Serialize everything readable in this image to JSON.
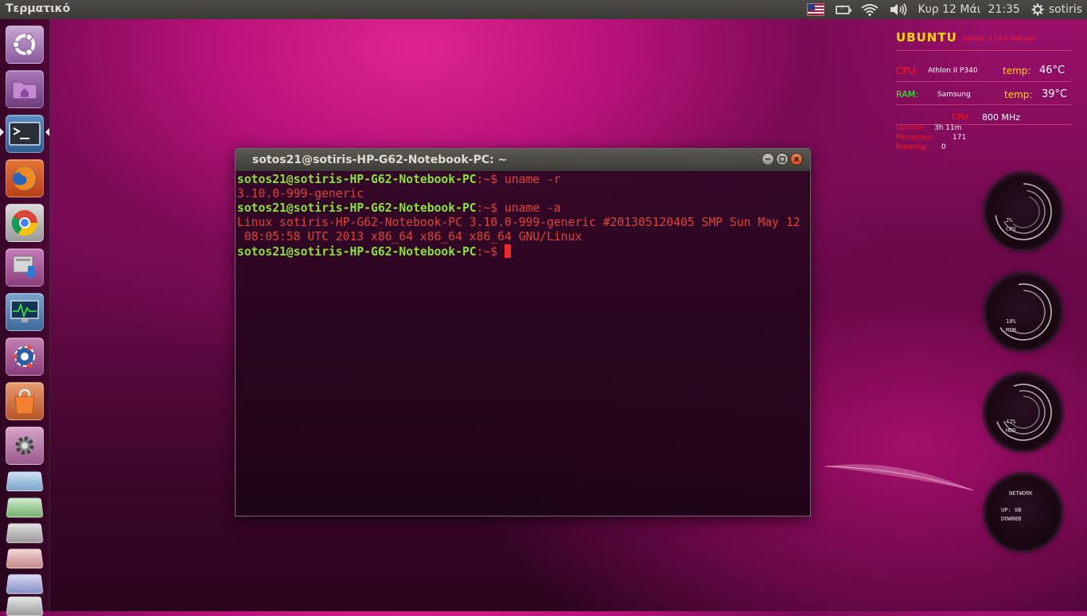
{
  "top_panel": {
    "app_title": "Τερματικό",
    "date": "Κυρ 12 Μάι",
    "time": "21:35",
    "user": "sotiris",
    "icons": [
      "us-flag-icon",
      "battery-icon",
      "wifi-icon",
      "volume-icon",
      "gear-icon"
    ]
  },
  "launcher": {
    "items": [
      "ubuntu-dash",
      "home-folder",
      "terminal",
      "firefox",
      "chrome",
      "software-updater",
      "system-monitor",
      "ubuntu-tweak",
      "software-center",
      "system-settings"
    ],
    "stacked_items": [
      "libreoffice-writer",
      "libreoffice-calc",
      "libreoffice-impress",
      "libreoffice-draw",
      "libreoffice-base",
      "disks"
    ]
  },
  "terminal": {
    "title": "sotos21@sotiris-HP-G62-Notebook-PC: ~",
    "lines": [
      {
        "type": "prompt",
        "user": "sotos21@sotiris-HP-G62-Notebook-PC",
        "path": ":~$ ",
        "cmd": "uname -r"
      },
      {
        "type": "output",
        "text": "3.10.0-999-generic"
      },
      {
        "type": "prompt",
        "user": "sotos21@sotiris-HP-G62-Notebook-PC",
        "path": ":~$ ",
        "cmd": "uname -a"
      },
      {
        "type": "output",
        "text": "Linux sotiris-HP-G62-Notebook-PC 3.10.0-999-generic #201305120405 SMP Sun May 12"
      },
      {
        "type": "output",
        "text": " 08:05:58 UTC 2013 x86_64 x86_64 x86_64 GNU/Linux"
      },
      {
        "type": "prompt",
        "user": "sotos21@sotiris-HP-G62-Notebook-PC",
        "path": ":~$ ",
        "cmd": ""
      }
    ]
  },
  "conky": {
    "os": "UBUNTU",
    "kernel": "Kernel: 3.10.0-999-gen",
    "cpu_label": "CPU:",
    "cpu_model": "Athlon II P340",
    "cpu_temp_label": "temp:",
    "cpu_temp": "46°C",
    "ram_label": "RAM:",
    "ram_model": "Samsung",
    "ram_temp_label": "temp:",
    "ram_temp": "39°C",
    "freq_label": "CPU:",
    "freq": "800 MHz",
    "uptime_label": "Uptime:",
    "uptime": "3h 11m",
    "processes_label": "Processes:",
    "processes": "171",
    "running_label": "Running:",
    "running": "0",
    "gauges": [
      {
        "value": "2%",
        "label": "CPU",
        "fraction": 0.02
      },
      {
        "value": "18%",
        "label": "MEM",
        "fraction": 0.18
      },
      {
        "value": "42%",
        "label": "HDD",
        "fraction": 0.42
      }
    ],
    "network": {
      "title": "NETWORK",
      "up_label": "UP:",
      "up": "0B",
      "down_label": "DOWN:",
      "down": "0B"
    }
  }
}
